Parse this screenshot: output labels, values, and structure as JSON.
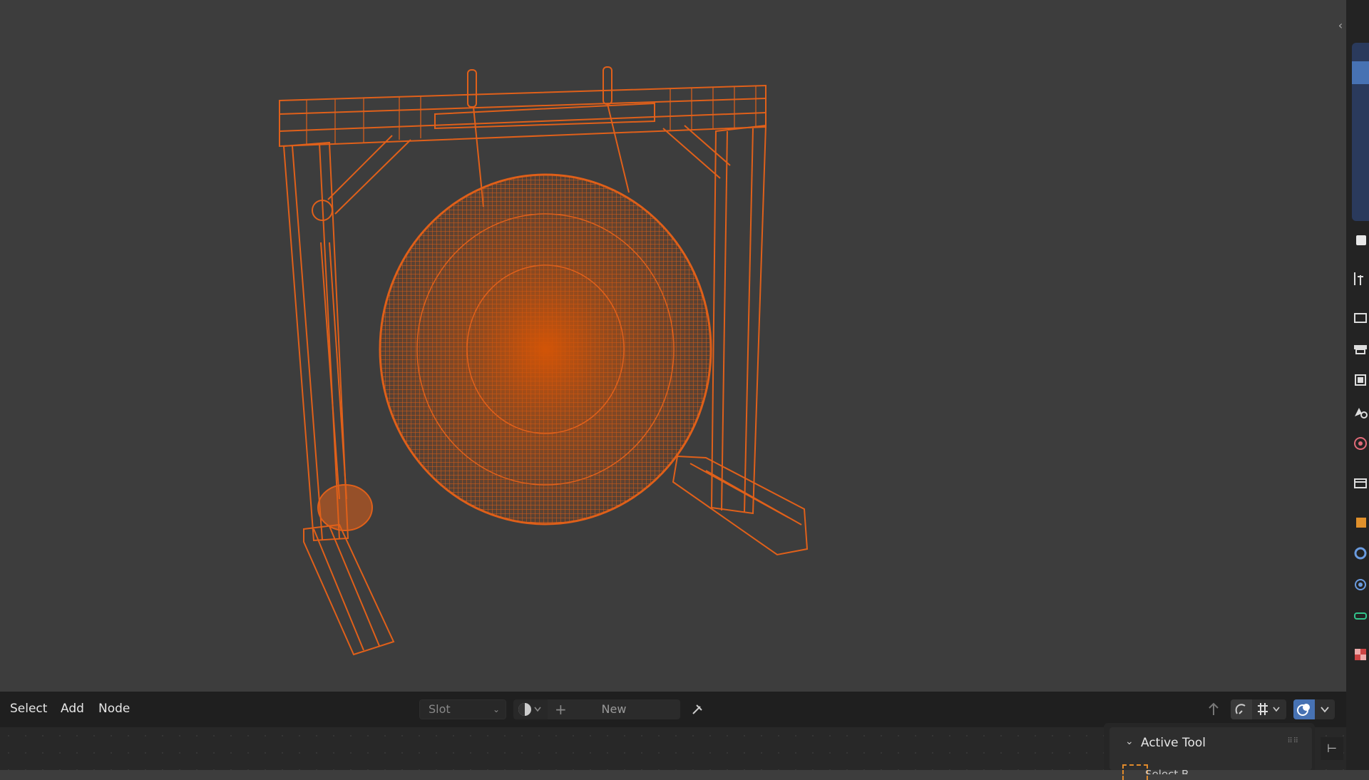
{
  "header": {
    "menus": [
      "Select",
      "Add",
      "Node"
    ],
    "slot_label": "Slot",
    "new_label": "New"
  },
  "active_tool": {
    "title": "Active Tool",
    "item_label": "Select B"
  },
  "colors": {
    "wire": "#e0601a",
    "accent_blue": "#4772b3",
    "viewport_bg": "#3d3d3d"
  }
}
